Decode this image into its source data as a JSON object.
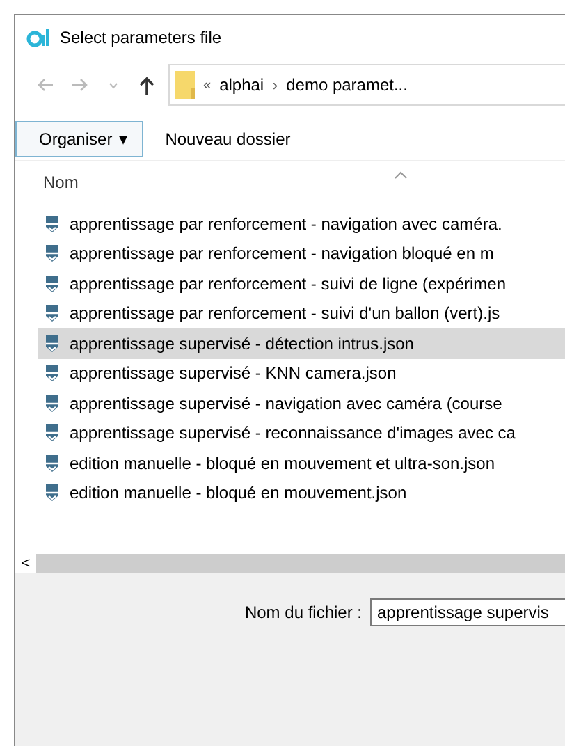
{
  "window": {
    "title": "Select parameters file"
  },
  "address_bar": {
    "overflow": "«",
    "crumbs": [
      {
        "label": "alphai"
      },
      {
        "label": "demo paramet..."
      }
    ],
    "separator": "›"
  },
  "toolbar": {
    "organize": {
      "label": "Organiser",
      "caret": "▾"
    },
    "new_folder": "Nouveau dossier"
  },
  "columns": [
    {
      "label": "Nom",
      "sorted": true
    }
  ],
  "files": [
    {
      "name": "apprentissage par renforcement - navigation avec caméra.",
      "selected": false
    },
    {
      "name": "apprentissage par renforcement - navigation bloqué en m",
      "selected": false
    },
    {
      "name": "apprentissage par renforcement - suivi de ligne (expérimen",
      "selected": false
    },
    {
      "name": "apprentissage par renforcement - suivi d'un ballon (vert).js",
      "selected": false
    },
    {
      "name": "apprentissage supervisé - détection intrus.json",
      "selected": true
    },
    {
      "name": "apprentissage supervisé - KNN camera.json",
      "selected": false
    },
    {
      "name": "apprentissage supervisé - navigation avec caméra (course",
      "selected": false
    },
    {
      "name": "apprentissage supervisé - reconnaissance d'images avec ca",
      "selected": false
    },
    {
      "name": "edition manuelle - bloqué en mouvement et ultra-son.json",
      "selected": false
    },
    {
      "name": "edition manuelle - bloqué en mouvement.json",
      "selected": false
    }
  ],
  "scroll_left": "<",
  "filename": {
    "label": "Nom du fichier :",
    "value": "apprentissage supervis"
  }
}
